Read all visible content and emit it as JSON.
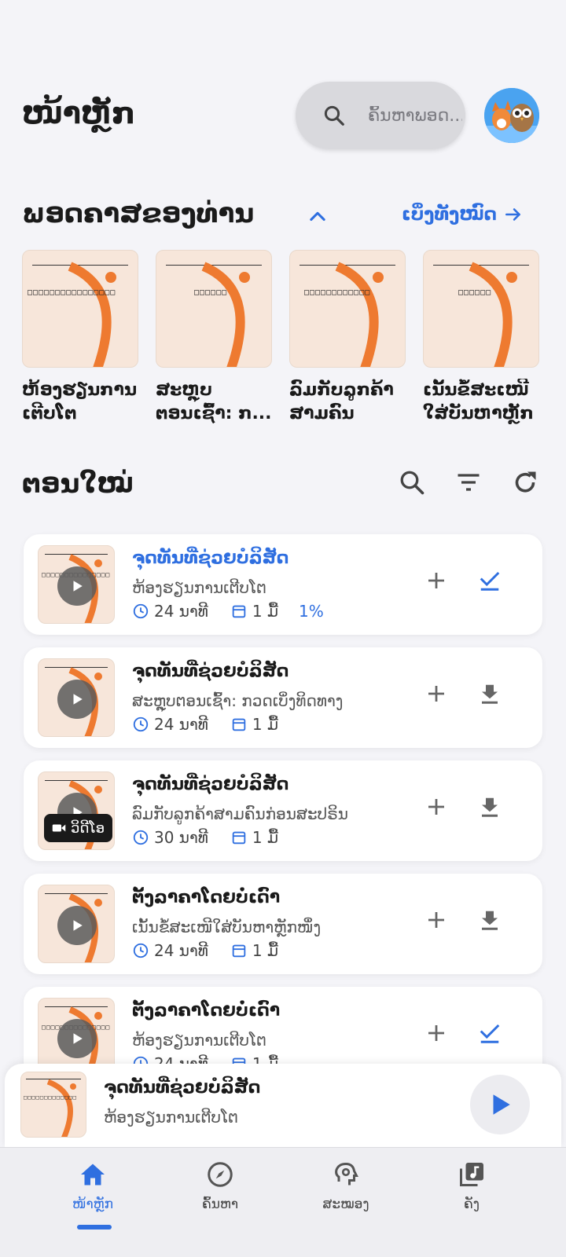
{
  "header": {
    "title": "ໜ້າຫຼັກ",
    "search_placeholder": "ຄົ້ນຫາພອດ..."
  },
  "podcasts_section": {
    "title": "ພອດຄາສຂອງທ່ານ",
    "see_all": "ເບິ່ງທັງໝົດ",
    "items": [
      {
        "label": "ຫ້ອງຮຽນການເຕີບໂຕ"
      },
      {
        "label": "ສະຫຼຸບຕອນເຊົ້າ: ກ..."
      },
      {
        "label": "ລົມກັບລູກຄ້າສາມຄົນກ່ອນ..."
      },
      {
        "label": "ເນັ້ນຂໍ້ສະເໜີໃສ່ບັນຫາຫຼັກໜຶ່ງ"
      }
    ]
  },
  "episodes_section": {
    "title": "ຕອນໃໝ່",
    "items": [
      {
        "title": "ຈຸດທັນທີ່ຊ່ວຍບໍລິສັດ",
        "podcast": "ຫ້ອງຮຽນການເຕີບໂຕ",
        "duration": "24 ນາທີ",
        "age": "1 ມື້",
        "progress": "1%",
        "downloaded": true
      },
      {
        "title": "ຈຸດທັນທີ່ຊ່ວຍບໍລິສັດ",
        "podcast": "ສະຫຼຸບຕອນເຊົ້າ: ກວດເບິ່ງທິດທາງ",
        "duration": "24 ນາທີ",
        "age": "1 ມື້",
        "downloaded": false
      },
      {
        "title": "ຈຸດທັນທີ່ຊ່ວຍບໍລິສັດ",
        "podcast": "ລົມກັບລູກຄ້າສາມຄົນກ່ອນສະປຣິນ",
        "duration": "30 ນາທີ",
        "age": "1 ມື້",
        "video_badge": "ວິດີໂອ",
        "downloaded": false
      },
      {
        "title": "ຕັ້ງລາຄາໂດຍບໍ່ເດົາ",
        "podcast": "ເນັ້ນຂໍ້ສະເໜີໃສ່ບັນຫາຫຼັກໜຶ່ງ",
        "duration": "24 ນາທີ",
        "age": "1 ມື້",
        "downloaded": false
      },
      {
        "title": "ຕັ້ງລາຄາໂດຍບໍ່ເດົາ",
        "podcast": "ຫ້ອງຮຽນການເຕີບໂຕ",
        "duration": "24 ນາທີ",
        "age": "1 ມື້",
        "downloaded": true
      }
    ]
  },
  "mini_player": {
    "title": "ຈຸດທັນທີ່ຊ່ວຍບໍລິສັດ",
    "podcast": "ຫ້ອງຮຽນການເຕີບໂຕ"
  },
  "nav": {
    "home": "ໜ້າຫຼັກ",
    "explore": "ຄົ້ນຫາ",
    "skills": "ສະໝອງ",
    "library": "ຄັງ"
  },
  "colors": {
    "accent": "#2f6fe0",
    "thumb_bg": "#f7e6da",
    "thumb_arc": "#ee7a30"
  }
}
